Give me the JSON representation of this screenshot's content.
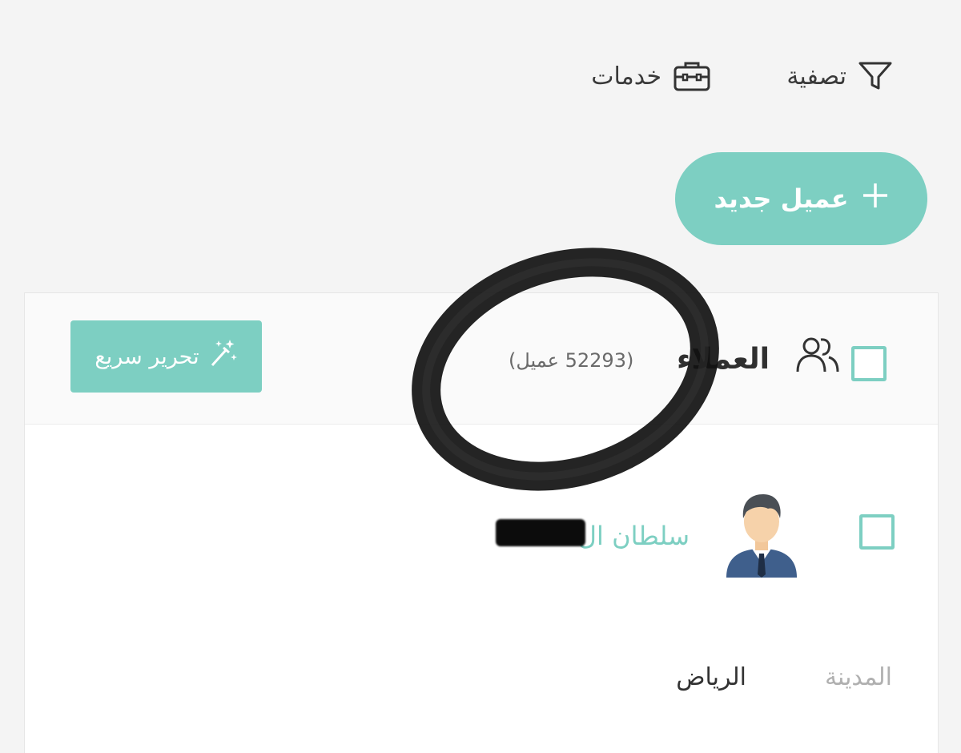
{
  "toolbar": {
    "filter_label": "تصفية",
    "services_label": "خدمات"
  },
  "actions": {
    "new_client_label": "عميل جديد"
  },
  "clients_header": {
    "title": "العملاء",
    "count_text": "(52293 عميل)",
    "quick_edit_label": "تحرير سريع"
  },
  "client_row": {
    "name": "سلطان ال",
    "city_label": "المدينة",
    "city_value": "الرياض"
  },
  "colors": {
    "accent": "#7dcfc2",
    "background": "#f4f4f4",
    "card": "#ffffff"
  }
}
